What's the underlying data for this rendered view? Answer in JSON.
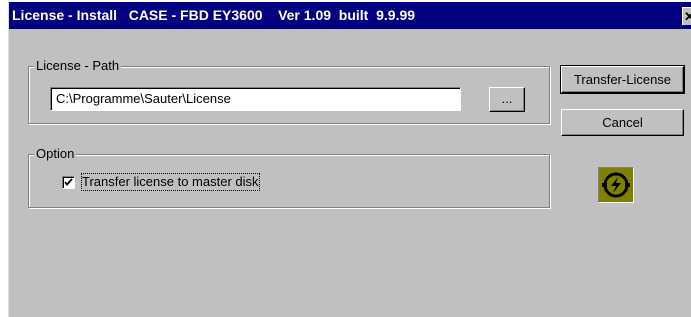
{
  "window": {
    "title": "License - Install   CASE - FBD EY3600    Ver 1.09  built  9.9.99",
    "close_glyph": "✕"
  },
  "license_path": {
    "group_label": "License - Path",
    "path_value": "C:\\Programme\\Sauter\\License",
    "browse_label": "..."
  },
  "option": {
    "group_label": "Option",
    "checkbox_label": "Transfer license to master disk",
    "checked": true
  },
  "buttons": {
    "transfer_label": "Transfer-License",
    "cancel_label": "Cancel"
  },
  "icons": {
    "logo": "sauter-logo-icon",
    "checkmark": "checkmark-icon",
    "close": "close-icon"
  },
  "colors": {
    "titlebar": "#000080",
    "face": "#c0c0c0",
    "logo_bg": "#808000"
  }
}
